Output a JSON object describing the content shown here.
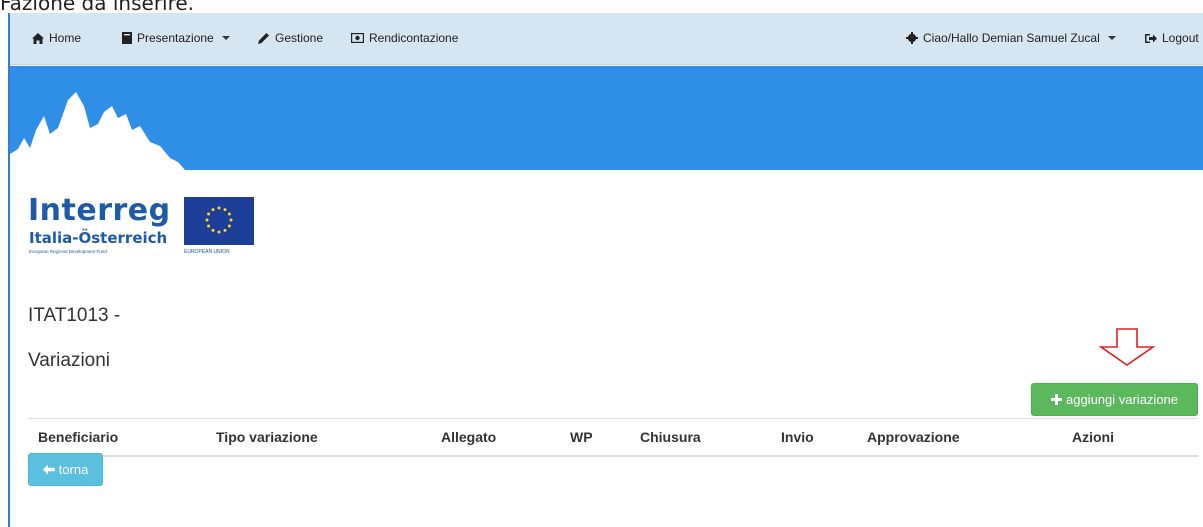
{
  "top_text": "Fazione da inserire.",
  "navbar": {
    "home": "Home",
    "presentazione": "Presentazione",
    "gestione": "Gestione",
    "rendicontazione": "Rendicontazione",
    "user": "Ciao/Hallo Demian Samuel Zucal",
    "logout": "Logout"
  },
  "logo": {
    "name": "Interreg",
    "region": "Italia-Österreich",
    "fund": "European Regional Development Fund",
    "eu": "EUROPEAN UNION"
  },
  "page": {
    "project_code": "ITAT1013 -",
    "section_title": "Variazioni"
  },
  "actions": {
    "add_variation": "aggiungi variazione",
    "back": "torna"
  },
  "table": {
    "columns": [
      "Beneficiario",
      "Tipo variazione",
      "Allegato",
      "WP",
      "Chiusura",
      "Invio",
      "Approvazione",
      "Azioni"
    ]
  },
  "colors": {
    "navbar_bg": "#d5e5f1",
    "banner_bg": "#2f8fe6",
    "success": "#5cb85c",
    "info": "#5bc0de",
    "brand_blue": "#1d5aa8",
    "annotation_red": "#e02020"
  }
}
